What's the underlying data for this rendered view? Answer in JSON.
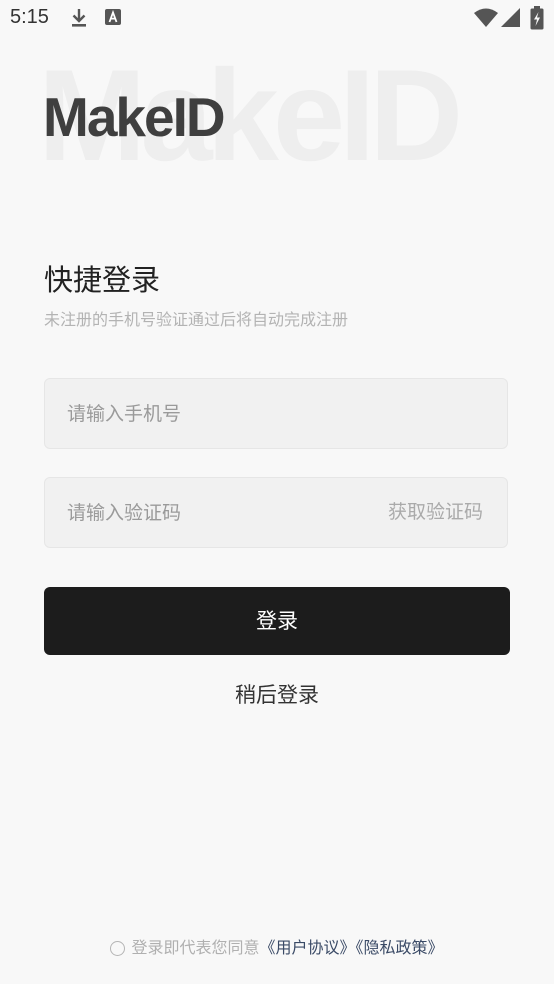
{
  "status_bar": {
    "time": "5:15",
    "icons": [
      "download-icon",
      "font-app-icon",
      "wifi-icon",
      "signal-icon",
      "battery-icon"
    ]
  },
  "logo": {
    "text": "MakeID",
    "background_text": "MakeID"
  },
  "login": {
    "title": "快捷登录",
    "subtitle": "未注册的手机号验证通过后将自动完成注册",
    "phone_placeholder": "请输入手机号",
    "code_placeholder": "请输入验证码",
    "get_code_label": "获取验证码",
    "login_button": "登录",
    "later_label": "稍后登录"
  },
  "agreement": {
    "prefix": "登录即代表您同意",
    "user_agreement": "《用户协议》",
    "privacy_policy": "《隐私政策》",
    "checked": false
  },
  "colors": {
    "background": "#f8f8f8",
    "primary_button": "#1c1c1c",
    "link": "#3a4a66",
    "hint": "#b3b3b3"
  }
}
